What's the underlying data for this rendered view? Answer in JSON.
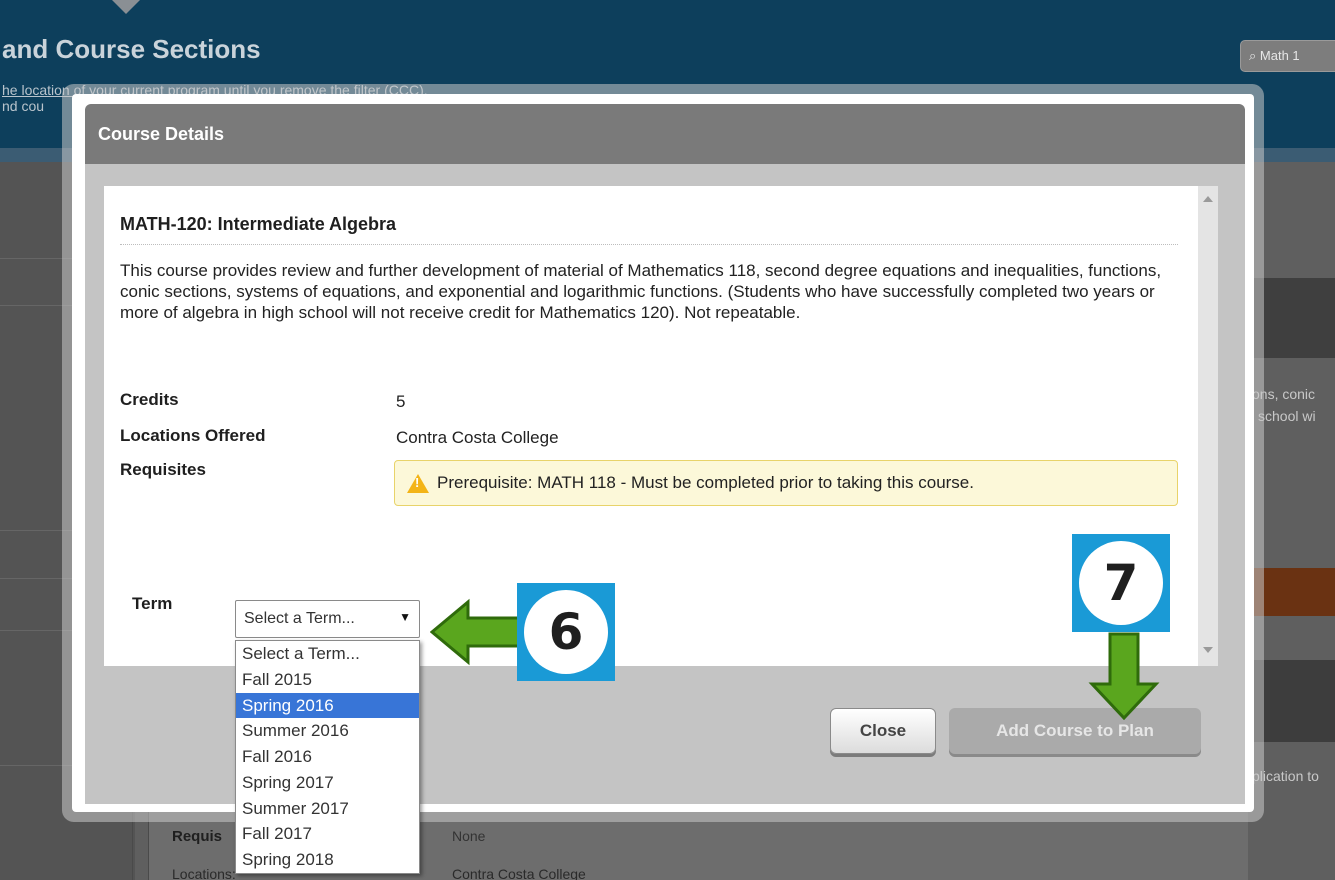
{
  "background": {
    "header_title": "and Course Sections",
    "filter_line1": "he location of your current program until you remove the filter (CCC).",
    "filter_line2": "nd cou",
    "search_text": "Math 1",
    "right_text_1": "ons, conic",
    "right_text_2": "school wi",
    "right_text_3": "plication to",
    "requisites_label": "Requis",
    "requisites_value": "None",
    "locations_label": "Locations:",
    "locations_value": "Contra Costa College"
  },
  "modal": {
    "title": "Course Details",
    "course_title": "MATH-120: Intermediate Algebra",
    "description": "This course provides review and further development of material of Mathematics 118, second degree equations and inequalities, functions, conic sections, systems of equations, and exponential and logarithmic functions. (Students who have successfully completed two years or more of algebra in high school will not receive credit for Mathematics 120). Not repeatable.",
    "credits_label": "Credits",
    "credits_value": "5",
    "locations_label": "Locations Offered",
    "locations_value": "Contra Costa College",
    "requisites_label": "Requisites",
    "prerequisite_text": "Prerequisite: MATH 118 - Must be completed prior to taking this course.",
    "term_label": "Term",
    "term_select_value": "Select a Term...",
    "term_options": [
      "Select a Term...",
      "Fall 2015",
      "Spring 2016",
      "Summer 2016",
      "Fall 2016",
      "Spring 2017",
      "Summer 2017",
      "Fall 2017",
      "Spring 2018"
    ],
    "highlighted_option": "Spring 2016",
    "close_button": "Close",
    "add_button": "Add Course to Plan"
  },
  "annotations": {
    "badge_6": "6",
    "badge_7": "7",
    "badge_color": "#1a9ad6",
    "arrow_color": "#5aa61e"
  }
}
